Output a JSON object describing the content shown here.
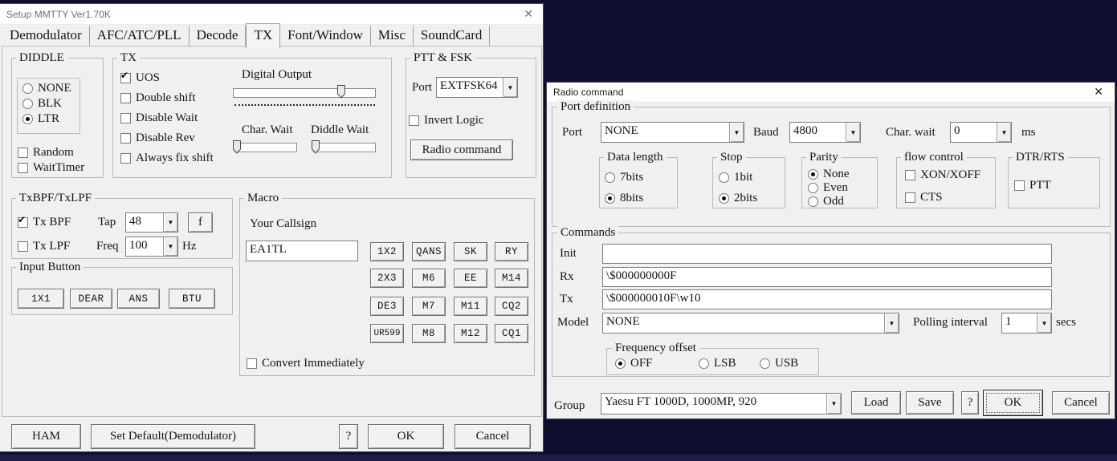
{
  "icons": {
    "close": "✕",
    "dropdown": "▼",
    "check": "✔"
  },
  "main": {
    "title": "Setup MMTTY Ver1.70K",
    "tabs": [
      "Demodulator",
      "AFC/ATC/PLL",
      "Decode",
      "TX",
      "Font/Window",
      "Misc",
      "SoundCard"
    ],
    "active_tab": "TX",
    "diddle": {
      "label": "DIDDLE",
      "none": "NONE",
      "blk": "BLK",
      "ltr": "LTR",
      "selected": "LTR",
      "random": "Random",
      "waittimer": "WaitTimer"
    },
    "tx": {
      "label": "TX",
      "uos": "UOS",
      "uos_checked": true,
      "double_shift": "Double shift",
      "disable_wait": "Disable Wait",
      "disable_rev": "Disable Rev",
      "always_fix": "Always fix shift",
      "digital_output": "Digital Output",
      "digital_output_percent": 76,
      "char_wait": "Char. Wait",
      "char_wait_percent": 0,
      "diddle_wait": "Diddle Wait",
      "diddle_wait_percent": 0
    },
    "ptt": {
      "label": "PTT & FSK",
      "port": "Port",
      "port_value": "EXTFSK64",
      "invert": "Invert Logic",
      "radio_command": "Radio command"
    },
    "filters": {
      "label": "TxBPF/TxLPF",
      "tx_bpf": "Tx BPF",
      "tx_bpf_checked": true,
      "tap": "Tap",
      "tap_value": "48",
      "f": "f",
      "tx_lpf": "Tx LPF",
      "tx_lpf_checked": false,
      "freq": "Freq",
      "freq_value": "100",
      "hz": "Hz"
    },
    "input_button": {
      "label": "Input Button",
      "buttons": [
        "1X1",
        "DEAR",
        "ANS",
        "BTU"
      ]
    },
    "macro": {
      "label": "Macro",
      "your_callsign": "Your Callsign",
      "callsign": "EA1TL",
      "rows": [
        [
          "1X2",
          "QANS",
          "SK",
          "RY"
        ],
        [
          "2X3",
          "M6",
          "EE",
          "M14"
        ],
        [
          "DE3",
          "M7",
          "M11",
          "CQ2"
        ],
        [
          "UR599",
          "M8",
          "M12",
          "CQ1"
        ]
      ],
      "convert": "Convert Immediately",
      "convert_checked": false
    },
    "bottom": {
      "ham": "HAM",
      "set_default": "Set Default(Demodulator)",
      "help": "?",
      "ok": "OK",
      "cancel": "Cancel"
    }
  },
  "radio": {
    "title": "Radio command",
    "port_def": {
      "label": "Port definition",
      "port": "Port",
      "port_value": "NONE",
      "baud": "Baud",
      "baud_value": "4800",
      "char_wait": "Char. wait",
      "char_wait_value": "0",
      "ms": "ms",
      "data_length": {
        "label": "Data length",
        "b7": "7bits",
        "b8": "8bits",
        "selected": "8bits"
      },
      "stop": {
        "label": "Stop",
        "b1": "1bit",
        "b2": "2bits",
        "selected": "2bits"
      },
      "parity": {
        "label": "Parity",
        "none": "None",
        "even": "Even",
        "odd": "Odd",
        "selected": "None"
      },
      "flow": {
        "label": "flow control",
        "xon": "XON/XOFF",
        "cts": "CTS"
      },
      "dtr": {
        "label": "DTR/RTS",
        "ptt": "PTT"
      }
    },
    "commands": {
      "label": "Commands",
      "init": "Init",
      "init_value": "",
      "rx": "Rx",
      "rx_value": "\\$000000000F",
      "tx": "Tx",
      "tx_value": "\\$000000010F\\w10",
      "model": "Model",
      "model_value": "NONE",
      "polling": "Polling interval",
      "polling_value": "1",
      "secs": "secs",
      "freq_offset": {
        "label": "Frequency offset",
        "off": "OFF",
        "lsb": "LSB",
        "usb": "USB",
        "selected": "OFF"
      }
    },
    "bottom": {
      "group": "Group",
      "group_value": "Yaesu FT 1000D, 1000MP, 920",
      "load": "Load",
      "save": "Save",
      "help": "?",
      "ok": "OK",
      "cancel": "Cancel"
    }
  }
}
